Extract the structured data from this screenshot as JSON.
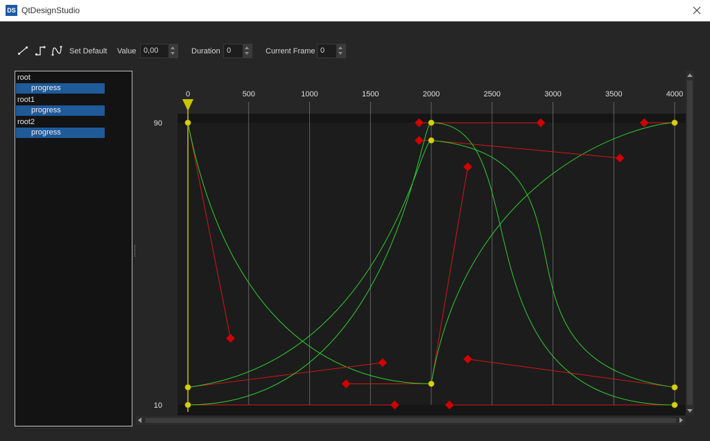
{
  "window": {
    "logo": "DS",
    "title": "QtDesignStudio",
    "close_icon": "close-icon"
  },
  "toolbar": {
    "linear_icon": "linear-interpolation-icon",
    "step_icon": "step-interpolation-icon",
    "spline_icon": "spline-interpolation-icon",
    "set_default": "Set Default",
    "value_label": "Value",
    "value": "0,00",
    "duration_label": "Duration",
    "duration": "0",
    "current_frame_label": "Current Frame",
    "current_frame": "0"
  },
  "tree": [
    {
      "name": "root",
      "property": "progress"
    },
    {
      "name": "root1",
      "property": "progress"
    },
    {
      "name": "root2",
      "property": "progress"
    }
  ],
  "graph": {
    "frame_ticks": [
      "0",
      "500",
      "1000",
      "1500",
      "2000",
      "2500",
      "3000",
      "3500",
      "4000"
    ],
    "value_labels": [
      "90",
      "10"
    ],
    "frame_range": [
      0,
      4000
    ],
    "value_range": [
      10,
      90
    ],
    "playhead_frame": 0,
    "colors": {
      "curve": "#2fd12f",
      "handle_line": "#d91515",
      "handle": "#d00000",
      "keyframe": "#d6cf12",
      "playhead": "#c9c400",
      "grid": "#9a9a9a"
    },
    "curves": [
      {
        "name": "root.progress",
        "segments": [
          {
            "p0": [
              0,
              90
            ],
            "c1": [
              350,
              28.9
            ],
            "c2": [
              1300,
              16
            ],
            "p3": [
              2000,
              16
            ]
          },
          {
            "p0": [
              2000,
              16
            ],
            "c1": [
              2300,
              77.5
            ],
            "c2": [
              3750,
              90
            ],
            "p3": [
              4000,
              90
            ]
          }
        ]
      },
      {
        "name": "root1.progress",
        "segments": [
          {
            "p0": [
              0,
              15
            ],
            "c1": [
              1600,
              22
            ],
            "c2": [
              1900,
              85
            ],
            "p3": [
              2000,
              85
            ]
          },
          {
            "p0": [
              2000,
              85
            ],
            "c1": [
              3550,
              80
            ],
            "c2": [
              2300,
              23
            ],
            "p3": [
              4000,
              15
            ]
          }
        ]
      },
      {
        "name": "root2.progress",
        "segments": [
          {
            "p0": [
              0,
              10
            ],
            "c1": [
              1700,
              10
            ],
            "c2": [
              1900,
              90
            ],
            "p3": [
              2000,
              90
            ]
          },
          {
            "p0": [
              2000,
              90
            ],
            "c1": [
              2900,
              90
            ],
            "c2": [
              2150,
              10
            ],
            "p3": [
              4000,
              10
            ]
          }
        ]
      }
    ]
  }
}
